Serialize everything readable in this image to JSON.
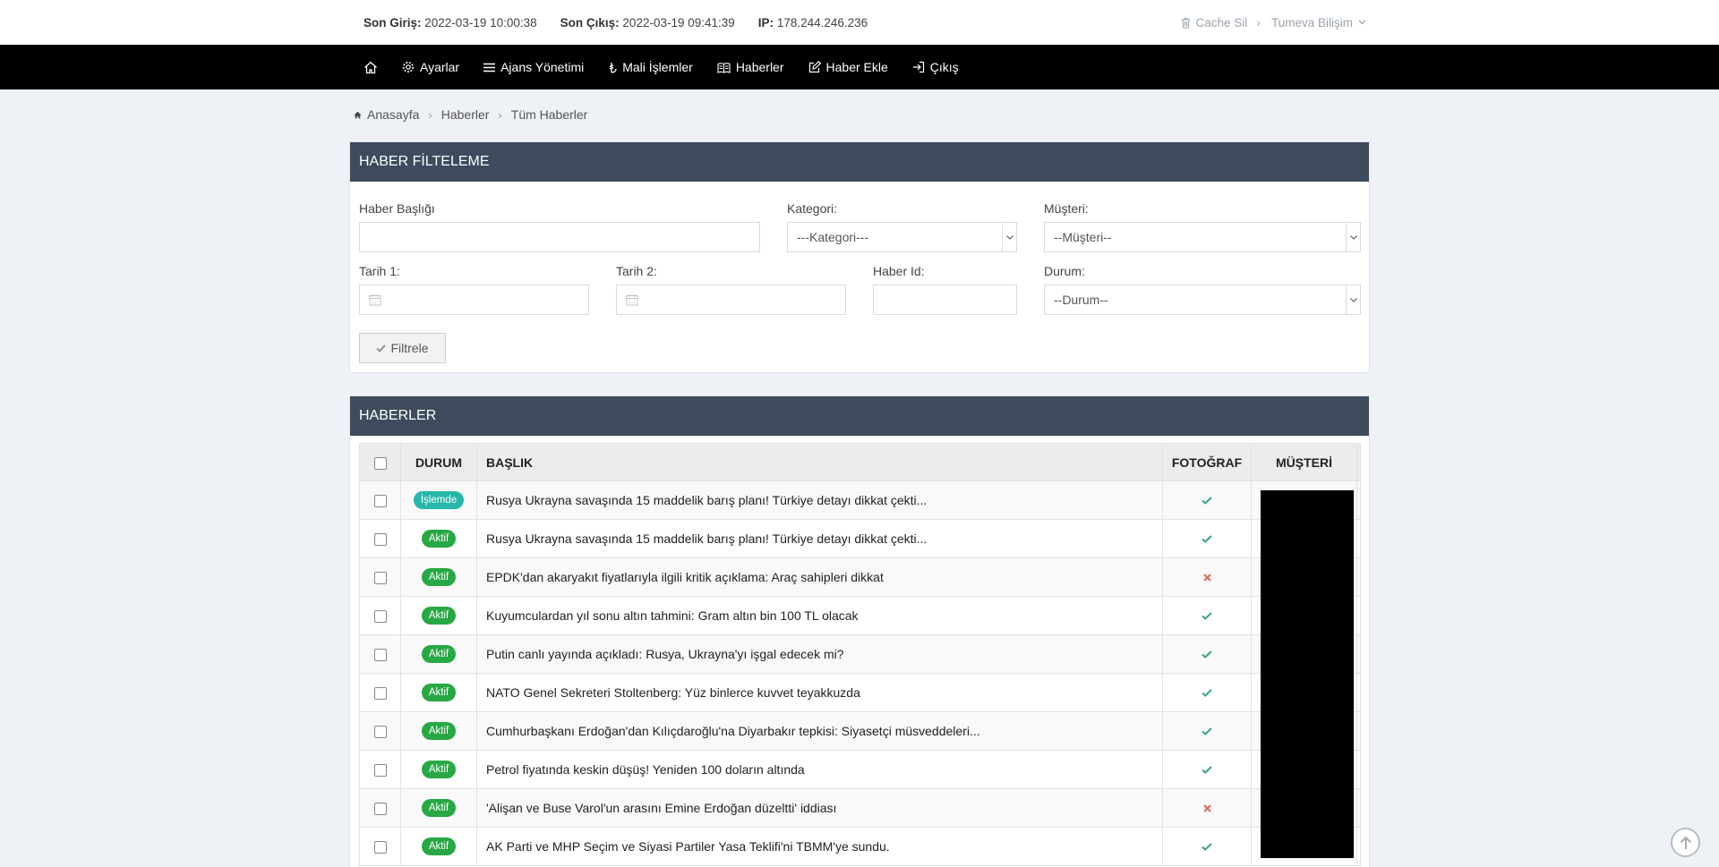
{
  "topbar": {
    "last_login_label": "Son Giriş:",
    "last_login_value": "2022-03-19 10:00:38",
    "last_logout_label": "Son Çıkış:",
    "last_logout_value": "2022-03-19 09:41:39",
    "ip_label": "IP:",
    "ip_value": "178.244.246.236",
    "cache_clear": "Cache Sil",
    "user_menu": "Tumeva Bilişim"
  },
  "nav": {
    "home_icon": "home-icon",
    "items": [
      {
        "label": "Ayarlar",
        "icon": "gear-icon"
      },
      {
        "label": "Ajans Yönetimi",
        "icon": "list-icon"
      },
      {
        "label": "Mali İşlemler",
        "icon": "money-icon"
      },
      {
        "label": "Haberler",
        "icon": "newspaper-icon"
      },
      {
        "label": "Haber Ekle",
        "icon": "edit-icon"
      },
      {
        "label": "Çıkış",
        "icon": "signout-icon"
      }
    ]
  },
  "breadcrumb": [
    "Anasayfa",
    "Haberler",
    "Tüm Haberler"
  ],
  "filter": {
    "title": "HABER FİLTELEME",
    "title_label": "Haber Başlığı",
    "title_value": "",
    "category_label": "Kategori:",
    "category_selected": "---Kategori---",
    "customer_label": "Müşteri:",
    "customer_selected": "--Müşteri--",
    "date1_label": "Tarih 1:",
    "date2_label": "Tarih 2:",
    "id_label": "Haber Id:",
    "status_label": "Durum:",
    "status_selected": "--Durum--",
    "button": "Filtrele"
  },
  "news": {
    "title": "HABERLER",
    "columns": [
      "DURUM",
      "BAŞLIK",
      "FOTOĞRAF",
      "MÜŞTERİ"
    ],
    "rows": [
      {
        "status": "İşlemde",
        "title": "Rusya Ukrayna savaşında 15 maddelik barış planı! Türkiye detayı dikkat çekti...",
        "photo": true
      },
      {
        "status": "Aktif",
        "title": "Rusya Ukrayna savaşında 15 maddelik barış planı! Türkiye detayı dikkat çekti...",
        "photo": true
      },
      {
        "status": "Aktif",
        "title": "EPDK'dan akaryakıt fiyatlarıyla ilgili kritik açıklama: Araç sahipleri dikkat",
        "photo": false
      },
      {
        "status": "Aktif",
        "title": "Kuyumculardan yıl sonu altın tahmini: Gram altın bin 100 TL olacak",
        "photo": true
      },
      {
        "status": "Aktif",
        "title": "Putin canlı yayında açıkladı: Rusya, Ukrayna'yı işgal edecek mi?",
        "photo": true
      },
      {
        "status": "Aktif",
        "title": "NATO Genel Sekreteri Stoltenberg: Yüz binlerce kuvvet teyakkuzda",
        "photo": true
      },
      {
        "status": "Aktif",
        "title": "Cumhurbaşkanı Erdoğan'dan Kılıçdaroğlu'na Diyarbakır tepkisi: Siyasetçi müsveddeleri...",
        "photo": true
      },
      {
        "status": "Aktif",
        "title": "Petrol fiyatında keskin düşüş! Yeniden 100 doların altında",
        "photo": true
      },
      {
        "status": "Aktif",
        "title": "'Alişan ve Buse Varol'un arasını Emine Erdoğan düzeltti' iddiası",
        "photo": false
      },
      {
        "status": "Aktif",
        "title": "AK Parti ve MHP Seçim ve Siyasi Partiler Yasa Teklifi'ni TBMM'ye sundu.",
        "photo": true
      }
    ]
  }
}
